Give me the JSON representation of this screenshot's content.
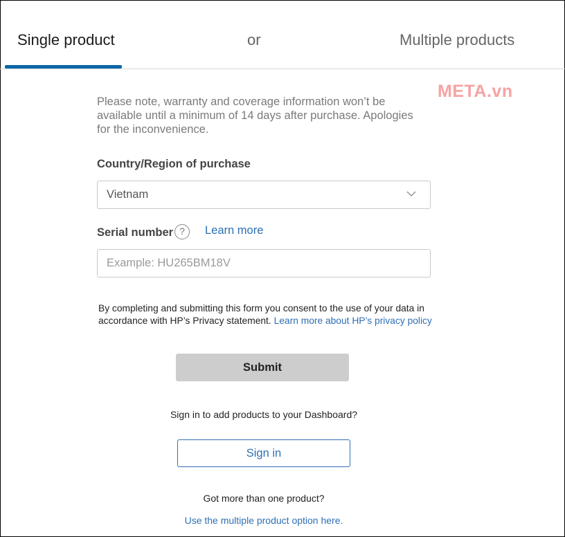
{
  "tabs": {
    "single": "Single product",
    "or": "or",
    "multiple": "Multiple products"
  },
  "watermark": "META.vn",
  "note": "Please note, warranty and coverage information won’t be available until a minimum of 14 days after purchase. Apologies for the inconvenience.",
  "country": {
    "label": "Country/Region of purchase",
    "value": "Vietnam",
    "icon": "chevron-down-icon"
  },
  "serial": {
    "label": "Serial number",
    "help_icon": "help-icon",
    "help_glyph": "?",
    "learn_more": "Learn more",
    "value": "",
    "placeholder": "Example: HU265BM18V"
  },
  "consent": {
    "text": "By completing and submitting this form you consent to the use of your data in accordance with HP’s Privacy statement.",
    "link": "Learn more about HP’s privacy policy"
  },
  "buttons": {
    "submit": "Submit",
    "sign_in": "Sign in"
  },
  "signin_prompt": "Sign in to add products to your Dashboard?",
  "more_prompt": "Got more than one product?",
  "multi_link": "Use the multiple product option here.",
  "colors": {
    "accent": "#0a67a8",
    "link": "#2e6fb5",
    "submit_bg": "#cdcdcd",
    "watermark": "#f6a3a3"
  }
}
